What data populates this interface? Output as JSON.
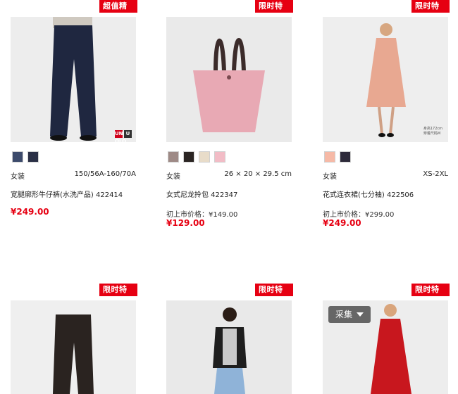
{
  "colors": {
    "badge": "#e60012",
    "price": "#e60012"
  },
  "products": [
    {
      "badge": "超值精选",
      "swatches": [
        "#3c4a6b",
        "#2a2f45"
      ],
      "category": "女装",
      "size": "150/56A-160/70A",
      "name": "宽腿廓形牛仔裤(水洗产品) 422414",
      "original_price": "",
      "price": "¥249.00",
      "logo": [
        "UNI QLO",
        "U"
      ]
    },
    {
      "badge": "限时特优",
      "swatches": [
        "#9e8a86",
        "#2b2523",
        "#e8dcc9",
        "#f2bcc6"
      ],
      "category": "女装",
      "size": "26 × 20 × 29.5 cm",
      "name": "女式尼龙拎包 422347",
      "original_price": "初上市价格：¥149.00",
      "price": "¥129.00"
    },
    {
      "badge": "限时特优",
      "swatches": [
        "#f6b9a6",
        "#2d2a3a"
      ],
      "category": "女装",
      "size": "XS-2XL",
      "name": "花式连衣裙(七分袖) 422506",
      "original_price": "初上市价格：¥299.00",
      "price": "¥249.00",
      "model_note": [
        "身高172cm",
        "穿着尺码M"
      ]
    },
    {
      "badge": "限时特优"
    },
    {
      "badge": "限时特优"
    },
    {
      "badge": "限时特优",
      "collect_label": "采集"
    }
  ]
}
